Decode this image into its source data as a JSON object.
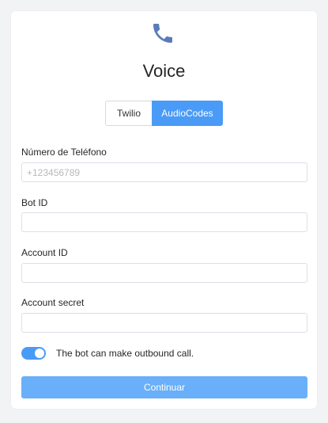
{
  "header": {
    "icon": "phone-icon",
    "title": "Voice"
  },
  "provider_tabs": {
    "items": [
      {
        "label": "Twilio",
        "selected": false
      },
      {
        "label": "AudioCodes",
        "selected": true
      }
    ]
  },
  "form": {
    "phone": {
      "label": "Número de Teléfono",
      "value": "",
      "placeholder": "+123456789"
    },
    "bot_id": {
      "label": "Bot ID",
      "value": "",
      "placeholder": ""
    },
    "account_id": {
      "label": "Account ID",
      "value": "",
      "placeholder": ""
    },
    "account_secret": {
      "label": "Account secret",
      "value": "",
      "placeholder": ""
    },
    "outbound_toggle": {
      "label": "The bot can make outbound call.",
      "checked": true
    },
    "submit_label": "Continuar"
  },
  "colors": {
    "accent": "#4a9bf7",
    "button": "#69aff9",
    "icon": "#5b7bb8",
    "background": "#f2f3f5"
  }
}
